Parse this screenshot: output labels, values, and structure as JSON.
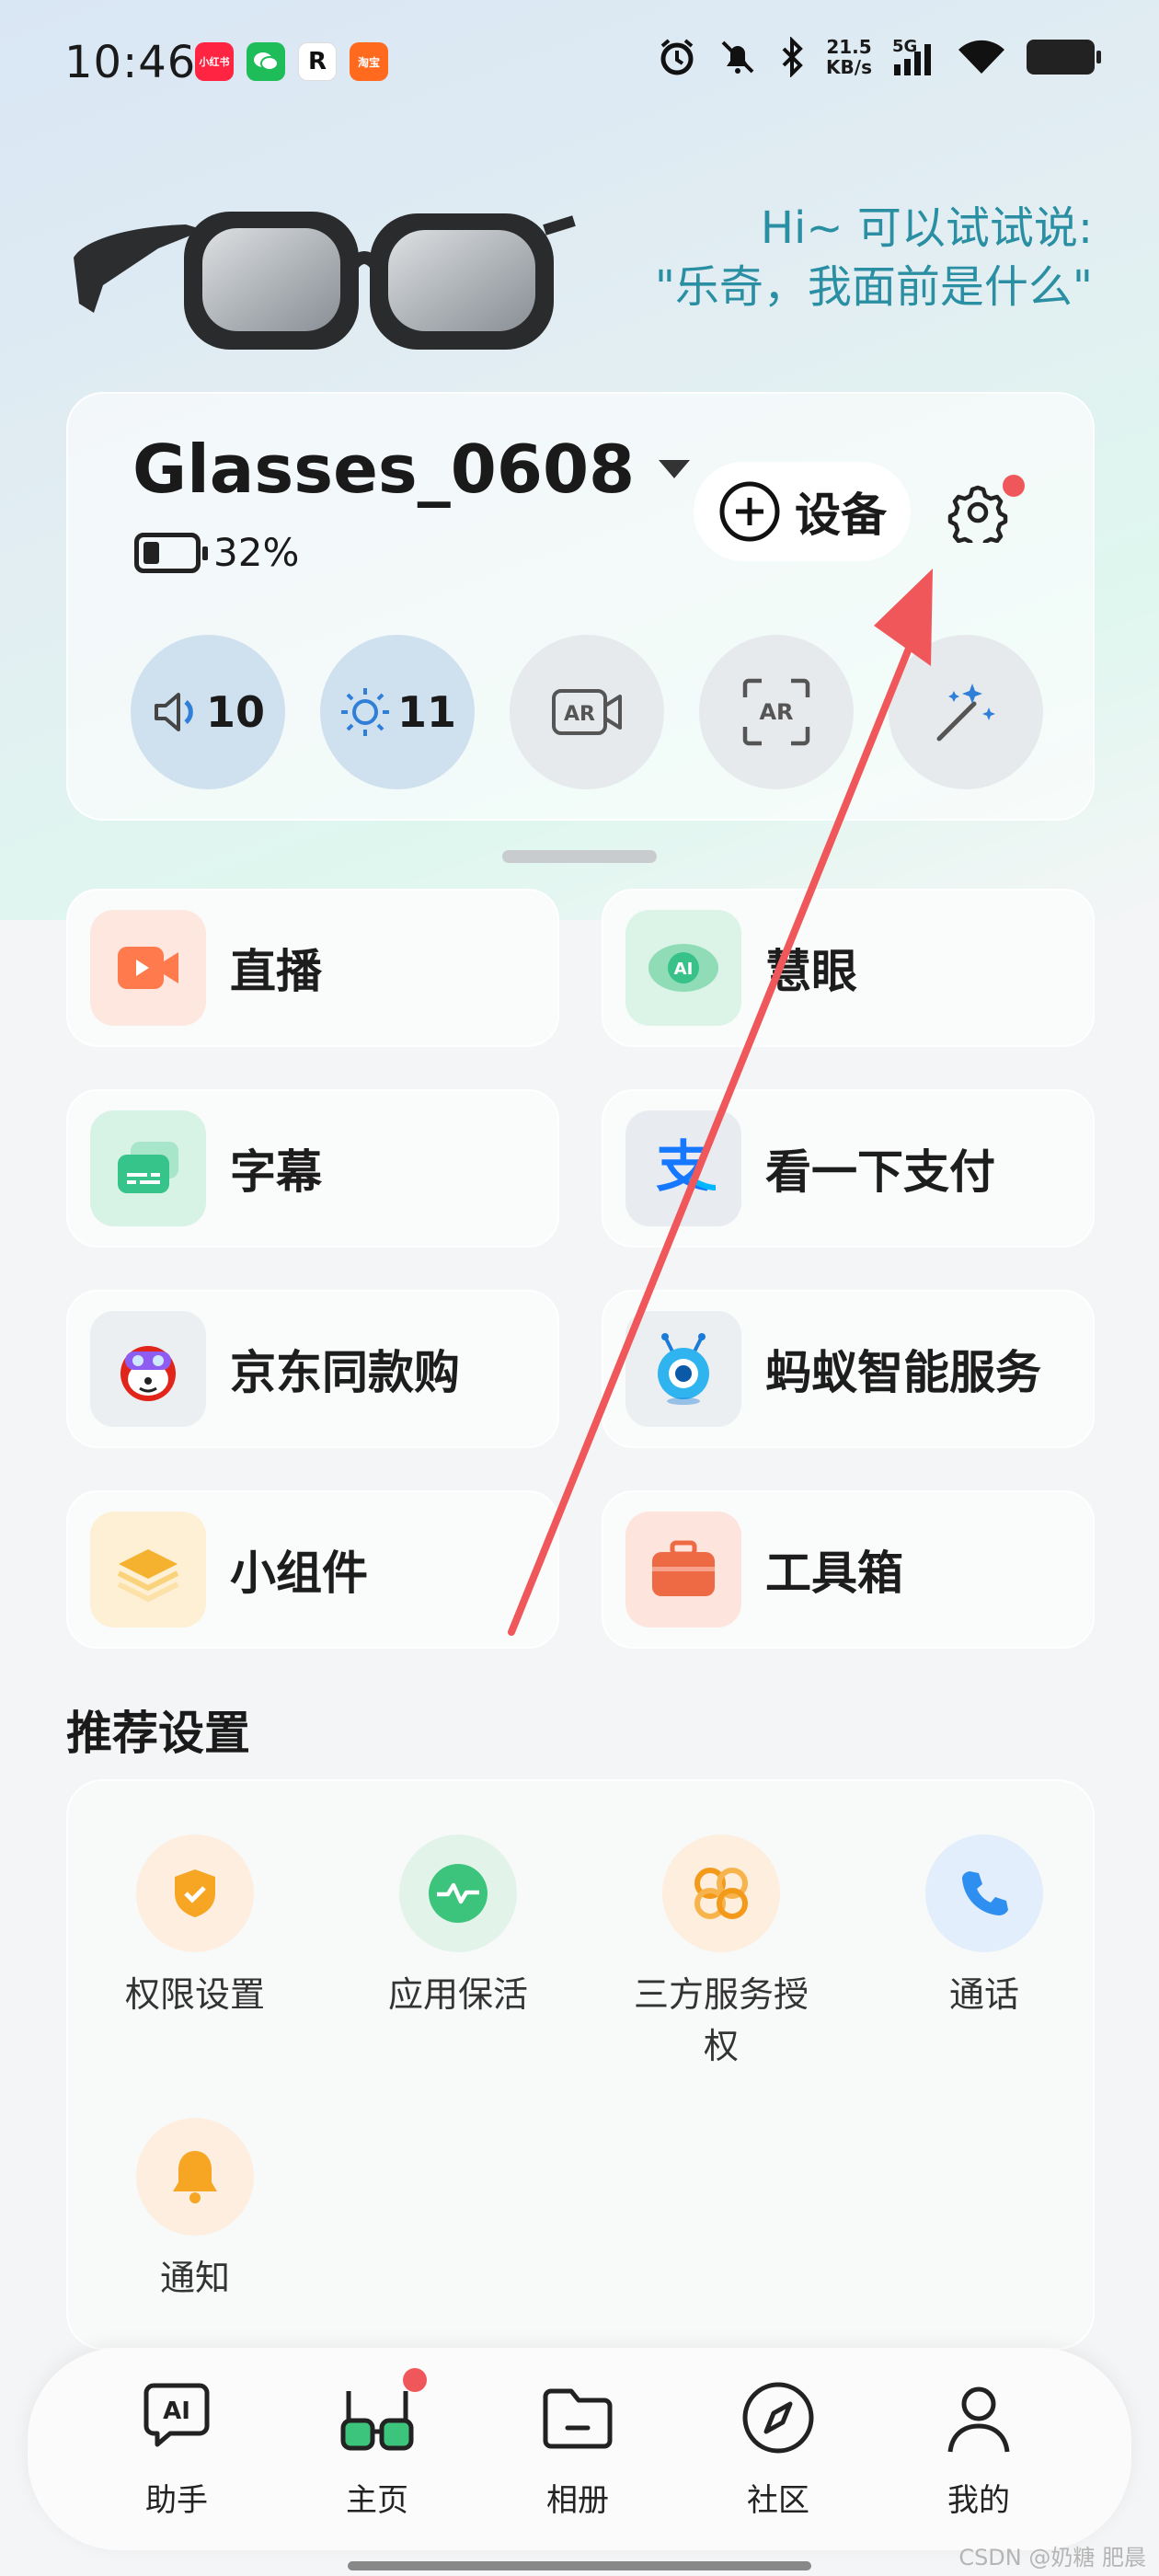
{
  "status_bar": {
    "time": "10:46",
    "notification_apps": [
      {
        "name": "xiaohongshu-icon",
        "text": "小红书",
        "color": "#ff2442"
      },
      {
        "name": "wechat-icon",
        "text": "",
        "color": "#1fbd5a"
      },
      {
        "name": "r-app-icon",
        "text": "R",
        "color": "#ffffff"
      },
      {
        "name": "taobao-flash-icon",
        "text": "淘宝",
        "color": "#ff6a1f"
      }
    ],
    "net_speed_value": "21.5",
    "net_speed_unit": "KB/s",
    "signal_label": "5G"
  },
  "hero": {
    "hint_line1": "Hi~ 可以试试说:",
    "hint_line2": "\"乐奇，我面前是什么\""
  },
  "device": {
    "name": "Glasses_0608",
    "battery_percent": "32%",
    "battery_level": 0.32,
    "add_device_label": "设备",
    "settings_has_badge": true,
    "quick_controls": [
      {
        "name": "volume",
        "icon": "volume-icon",
        "value": "10",
        "active": true
      },
      {
        "name": "brightness",
        "icon": "brightness-icon",
        "value": "11",
        "active": true
      },
      {
        "name": "ar-record",
        "icon": "ar-record-icon",
        "value": "",
        "active": false
      },
      {
        "name": "ar-scan",
        "icon": "ar-scan-icon",
        "value": "",
        "active": false
      },
      {
        "name": "magic",
        "icon": "magic-wand-icon",
        "value": "",
        "active": false
      }
    ]
  },
  "features": [
    {
      "name": "live",
      "label": "直播",
      "icon": "live-video-icon",
      "color": "#ff7a4d"
    },
    {
      "name": "smart-eye",
      "label": "慧眼",
      "icon": "ai-eye-icon",
      "color": "#38c28a"
    },
    {
      "name": "subtitles",
      "label": "字幕",
      "icon": "subtitles-icon",
      "color": "#36c48a"
    },
    {
      "name": "pay",
      "label": "看一下支付",
      "icon": "alipay-icon",
      "color": "#1677ff"
    },
    {
      "name": "jd-same",
      "label": "京东同款购",
      "icon": "jd-mascot-icon",
      "color": "#e1251b"
    },
    {
      "name": "ant-service",
      "label": "蚂蚁智能服务",
      "icon": "ant-mascot-icon",
      "color": "#1aa1f0"
    },
    {
      "name": "widgets",
      "label": "小组件",
      "icon": "layers-icon",
      "color": "#f5b22f"
    },
    {
      "name": "toolbox",
      "label": "工具箱",
      "icon": "toolbox-icon",
      "color": "#ee6a45"
    }
  ],
  "recommended": {
    "title": "推荐设置",
    "items": [
      {
        "name": "permissions",
        "label": "权限设置",
        "icon": "shield-check-icon",
        "color": "#f6a623",
        "bg": "#fdeee0"
      },
      {
        "name": "keep-alive",
        "label": "应用保活",
        "icon": "heartbeat-icon",
        "color": "#3cc47c",
        "bg": "#e2f4ea"
      },
      {
        "name": "third-party",
        "label": "三方服务授权",
        "icon": "infinity-icon",
        "color": "#f39a1b",
        "bg": "#fdeedd"
      },
      {
        "name": "calls",
        "label": "通话",
        "icon": "phone-icon",
        "color": "#2f8ff0",
        "bg": "#e2eefb"
      },
      {
        "name": "notifications",
        "label": "通知",
        "icon": "bell-icon",
        "color": "#f6a623",
        "bg": "#fdeee0"
      }
    ]
  },
  "nav": [
    {
      "name": "assistant",
      "label": "助手",
      "icon": "ai-chat-icon",
      "badge": false
    },
    {
      "name": "home",
      "label": "主页",
      "icon": "glasses-icon",
      "badge": true
    },
    {
      "name": "album",
      "label": "相册",
      "icon": "folder-icon",
      "badge": false
    },
    {
      "name": "community",
      "label": "社区",
      "icon": "compass-icon",
      "badge": false
    },
    {
      "name": "mine",
      "label": "我的",
      "icon": "person-icon",
      "badge": false
    }
  ],
  "watermark": "CSDN @奶糖 肥晨",
  "colors": {
    "accent_red": "#f0575a",
    "hint_teal": "#2a8fa3",
    "annotation_arrow": "#f0575a"
  }
}
